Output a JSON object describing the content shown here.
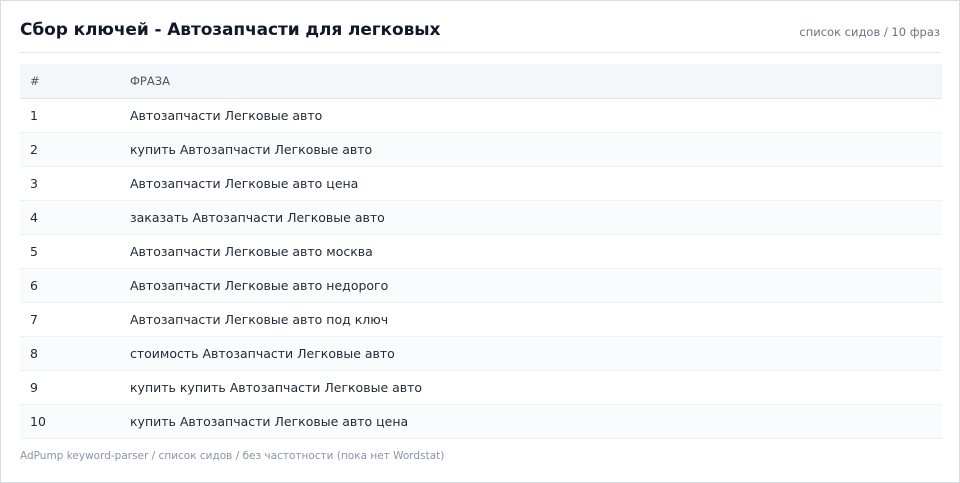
{
  "header": {
    "title": "Сбор ключей - Автозапчасти для легковых",
    "subtitle": "список сидов / 10 фраз"
  },
  "table": {
    "columns": [
      "#",
      "ФРАЗА"
    ],
    "rows": [
      {
        "num": "1",
        "phrase": "Автозапчасти Легковые авто"
      },
      {
        "num": "2",
        "phrase": "купить Автозапчасти Легковые авто"
      },
      {
        "num": "3",
        "phrase": "Автозапчасти Легковые авто цена"
      },
      {
        "num": "4",
        "phrase": "заказать Автозапчасти Легковые авто"
      },
      {
        "num": "5",
        "phrase": "Автозапчасти Легковые авто москва"
      },
      {
        "num": "6",
        "phrase": "Автозапчасти Легковые авто недорого"
      },
      {
        "num": "7",
        "phrase": "Автозапчасти Легковые авто под ключ"
      },
      {
        "num": "8",
        "phrase": "стоимость Автозапчасти Легковые авто"
      },
      {
        "num": "9",
        "phrase": "купить купить Автозапчасти Легковые авто"
      },
      {
        "num": "10",
        "phrase": "купить Автозапчасти Легковые авто цена"
      }
    ]
  },
  "footer": {
    "text": "AdPump keyword-parser / список сидов / без частотности (пока нет Wordstat)"
  }
}
